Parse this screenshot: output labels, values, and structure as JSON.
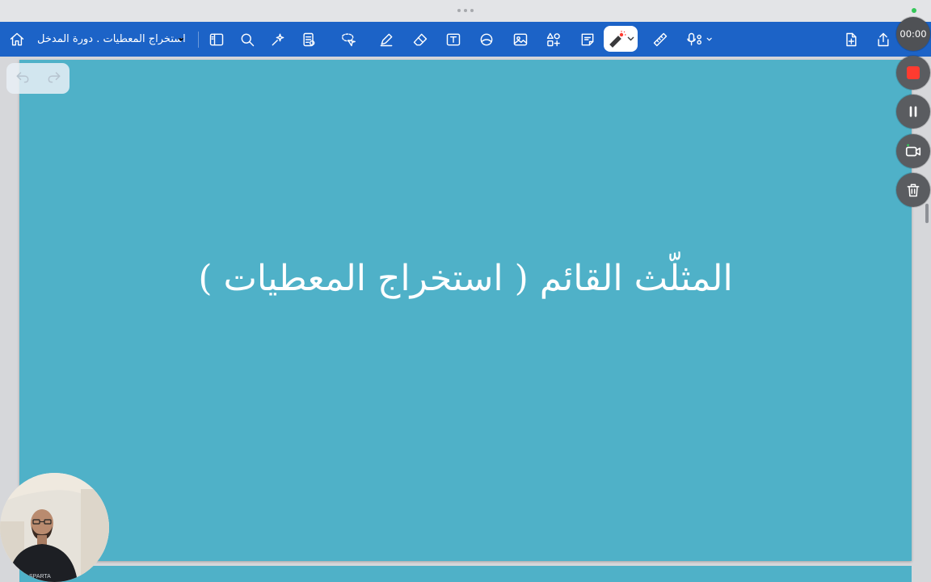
{
  "toolbar": {
    "document_title": "استخراج المعطيات . دورة المدخل",
    "icons": [
      "home-icon",
      "chevron-down-icon",
      "sidebar-icon",
      "search-icon",
      "ai-sparkle-icon",
      "document-list-icon",
      "lasso-icon",
      "pen-icon",
      "eraser-icon",
      "text-box-icon",
      "shape-icon",
      "image-icon",
      "elements-icon",
      "sticky-note-icon",
      "laser-pointer-icon",
      "ruler-icon",
      "microphone-icon",
      "add-page-icon",
      "share-icon"
    ]
  },
  "slide": {
    "title": "المثلّث القائم ( استخراج المعطيات )",
    "background_color": "#4fb1c8"
  },
  "recording": {
    "time": "00:00",
    "stop_color": "#ff3b30"
  },
  "colors": {
    "toolbar": "#1c63c7",
    "accent_green": "#34c759"
  }
}
